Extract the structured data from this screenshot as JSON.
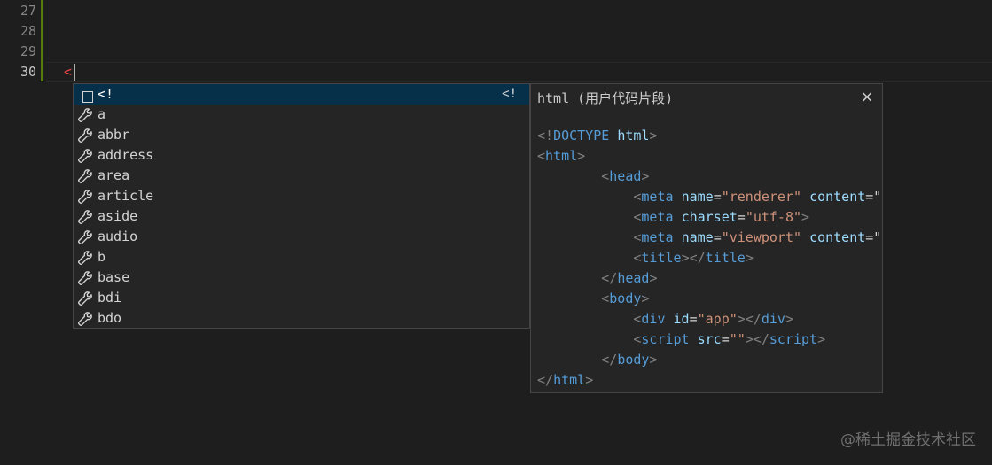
{
  "gutter": {
    "lines": [
      "27",
      "28",
      "29",
      "30"
    ]
  },
  "editor": {
    "typed_text": "<"
  },
  "suggest": {
    "items": [
      {
        "label": "<!",
        "detail": "<!",
        "kind": "snippet"
      },
      {
        "label": "a",
        "kind": "property"
      },
      {
        "label": "abbr",
        "kind": "property"
      },
      {
        "label": "address",
        "kind": "property"
      },
      {
        "label": "area",
        "kind": "property"
      },
      {
        "label": "article",
        "kind": "property"
      },
      {
        "label": "aside",
        "kind": "property"
      },
      {
        "label": "audio",
        "kind": "property"
      },
      {
        "label": "b",
        "kind": "property"
      },
      {
        "label": "base",
        "kind": "property"
      },
      {
        "label": "bdi",
        "kind": "property"
      },
      {
        "label": "bdo",
        "kind": "property"
      }
    ]
  },
  "details": {
    "title": "html (用户代码片段)",
    "close_icon": "×",
    "code": [
      [
        {
          "t": "<!",
          "c": "t-punct"
        },
        {
          "t": "DOCTYPE",
          "c": "t-doc"
        },
        {
          "t": " ",
          "c": "t-plain"
        },
        {
          "t": "html",
          "c": "t-attr"
        },
        {
          "t": ">",
          "c": "t-punct"
        }
      ],
      [
        {
          "t": "<",
          "c": "t-punct"
        },
        {
          "t": "html",
          "c": "t-tag"
        },
        {
          "t": ">",
          "c": "t-punct"
        }
      ],
      [
        {
          "t": "        ",
          "c": "t-plain"
        },
        {
          "t": "<",
          "c": "t-punct"
        },
        {
          "t": "head",
          "c": "t-tag"
        },
        {
          "t": ">",
          "c": "t-punct"
        }
      ],
      [
        {
          "t": "            ",
          "c": "t-plain"
        },
        {
          "t": "<",
          "c": "t-punct"
        },
        {
          "t": "meta",
          "c": "t-tag"
        },
        {
          "t": " ",
          "c": "t-plain"
        },
        {
          "t": "name",
          "c": "t-attr"
        },
        {
          "t": "=",
          "c": "t-plain"
        },
        {
          "t": "\"renderer\"",
          "c": "t-str"
        },
        {
          "t": " ",
          "c": "t-plain"
        },
        {
          "t": "content",
          "c": "t-attr"
        },
        {
          "t": "=\"",
          "c": "t-plain"
        }
      ],
      [
        {
          "t": "            ",
          "c": "t-plain"
        },
        {
          "t": "<",
          "c": "t-punct"
        },
        {
          "t": "meta",
          "c": "t-tag"
        },
        {
          "t": " ",
          "c": "t-plain"
        },
        {
          "t": "charset",
          "c": "t-attr"
        },
        {
          "t": "=",
          "c": "t-plain"
        },
        {
          "t": "\"utf-8\"",
          "c": "t-str"
        },
        {
          "t": ">",
          "c": "t-punct"
        }
      ],
      [
        {
          "t": "            ",
          "c": "t-plain"
        },
        {
          "t": "<",
          "c": "t-punct"
        },
        {
          "t": "meta",
          "c": "t-tag"
        },
        {
          "t": " ",
          "c": "t-plain"
        },
        {
          "t": "name",
          "c": "t-attr"
        },
        {
          "t": "=",
          "c": "t-plain"
        },
        {
          "t": "\"viewport\"",
          "c": "t-str"
        },
        {
          "t": " ",
          "c": "t-plain"
        },
        {
          "t": "content",
          "c": "t-attr"
        },
        {
          "t": "=\"",
          "c": "t-plain"
        }
      ],
      [
        {
          "t": "            ",
          "c": "t-plain"
        },
        {
          "t": "<",
          "c": "t-punct"
        },
        {
          "t": "title",
          "c": "t-tag"
        },
        {
          "t": "></",
          "c": "t-punct"
        },
        {
          "t": "title",
          "c": "t-tag"
        },
        {
          "t": ">",
          "c": "t-punct"
        }
      ],
      [
        {
          "t": "        ",
          "c": "t-plain"
        },
        {
          "t": "</",
          "c": "t-punct"
        },
        {
          "t": "head",
          "c": "t-tag"
        },
        {
          "t": ">",
          "c": "t-punct"
        }
      ],
      [
        {
          "t": "        ",
          "c": "t-plain"
        },
        {
          "t": "<",
          "c": "t-punct"
        },
        {
          "t": "body",
          "c": "t-tag"
        },
        {
          "t": ">",
          "c": "t-punct"
        }
      ],
      [
        {
          "t": "            ",
          "c": "t-plain"
        },
        {
          "t": "<",
          "c": "t-punct"
        },
        {
          "t": "div",
          "c": "t-tag"
        },
        {
          "t": " ",
          "c": "t-plain"
        },
        {
          "t": "id",
          "c": "t-attr"
        },
        {
          "t": "=",
          "c": "t-plain"
        },
        {
          "t": "\"app\"",
          "c": "t-str"
        },
        {
          "t": "></",
          "c": "t-punct"
        },
        {
          "t": "div",
          "c": "t-tag"
        },
        {
          "t": ">",
          "c": "t-punct"
        }
      ],
      [
        {
          "t": "            ",
          "c": "t-plain"
        },
        {
          "t": "<",
          "c": "t-punct"
        },
        {
          "t": "script",
          "c": "t-tag"
        },
        {
          "t": " ",
          "c": "t-plain"
        },
        {
          "t": "src",
          "c": "t-attr"
        },
        {
          "t": "=",
          "c": "t-plain"
        },
        {
          "t": "\"\"",
          "c": "t-str"
        },
        {
          "t": "></",
          "c": "t-punct"
        },
        {
          "t": "script",
          "c": "t-tag"
        },
        {
          "t": ">",
          "c": "t-punct"
        }
      ],
      [
        {
          "t": "        ",
          "c": "t-plain"
        },
        {
          "t": "</",
          "c": "t-punct"
        },
        {
          "t": "body",
          "c": "t-tag"
        },
        {
          "t": ">",
          "c": "t-punct"
        }
      ],
      [
        {
          "t": "</",
          "c": "t-punct"
        },
        {
          "t": "html",
          "c": "t-tag"
        },
        {
          "t": ">",
          "c": "t-punct"
        }
      ]
    ]
  },
  "watermark": "@稀土掘金技术社区",
  "colors": {
    "editor_bg": "#1e1e1e",
    "widget_bg": "#252526",
    "focused_row": "#062f4a",
    "git_added": "#587c0c",
    "typed_bracket": "#f44747"
  }
}
